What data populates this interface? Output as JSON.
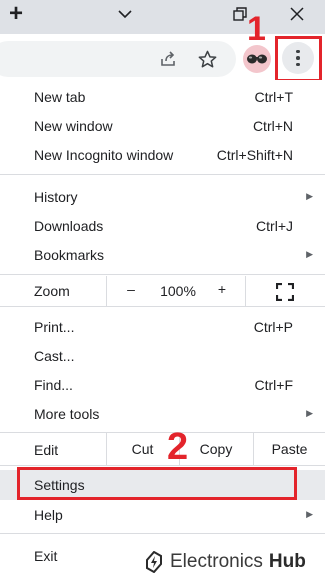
{
  "titlebar": {
    "new_tab_symbol": "+",
    "minimize_icon": "chevron-down-icon",
    "restore_icon": "restore-icon",
    "close_icon": "close-icon"
  },
  "toolbar": {
    "share_icon": "share-icon",
    "bookmark_icon": "star-icon",
    "profile_icon": "sunglasses-avatar",
    "menu_icon": "kebab-menu-icon"
  },
  "annotations": {
    "step1": "1",
    "step2": "2",
    "color": "#e3242b"
  },
  "menu": {
    "new_tab": {
      "label": "New tab",
      "shortcut": "Ctrl+T"
    },
    "new_window": {
      "label": "New window",
      "shortcut": "Ctrl+N"
    },
    "new_incognito": {
      "label": "New Incognito window",
      "shortcut": "Ctrl+Shift+N"
    },
    "history": {
      "label": "History"
    },
    "downloads": {
      "label": "Downloads",
      "shortcut": "Ctrl+J"
    },
    "bookmarks": {
      "label": "Bookmarks"
    },
    "zoom": {
      "label": "Zoom",
      "minus": "–",
      "value": "100%",
      "plus": "+"
    },
    "print": {
      "label": "Print...",
      "shortcut": "Ctrl+P"
    },
    "cast": {
      "label": "Cast..."
    },
    "find": {
      "label": "Find...",
      "shortcut": "Ctrl+F"
    },
    "more_tools": {
      "label": "More tools"
    },
    "edit": {
      "label": "Edit",
      "cut": "Cut",
      "copy": "Copy",
      "paste": "Paste"
    },
    "settings": {
      "label": "Settings"
    },
    "help": {
      "label": "Help"
    },
    "exit": {
      "label": "Exit"
    }
  },
  "watermark": {
    "part1": "Electronics",
    "part2": "Hub"
  }
}
